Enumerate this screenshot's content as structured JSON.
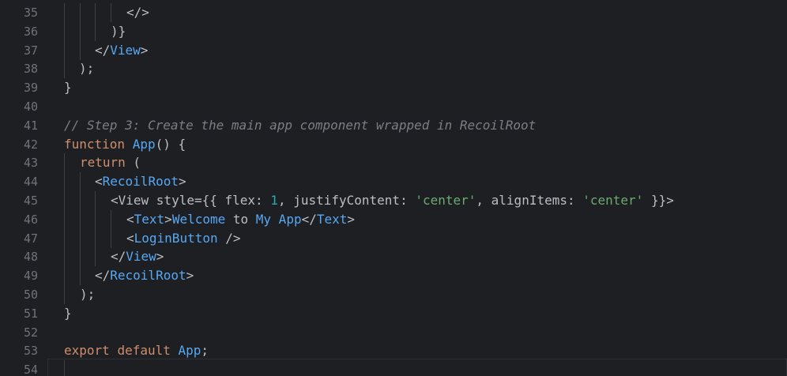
{
  "editor": {
    "lines": [
      {
        "n": "35",
        "parts": [
          {
            "t": "</>",
            "c": "br"
          }
        ]
      },
      {
        "n": "36",
        "parts": [
          {
            "t": ")}",
            "c": "br"
          }
        ]
      },
      {
        "n": "37",
        "parts": [
          {
            "t": "</",
            "c": "br"
          },
          {
            "t": "View",
            "c": "tag"
          },
          {
            "t": ">",
            "c": "br"
          }
        ]
      },
      {
        "n": "38",
        "parts": [
          {
            "t": ");",
            "c": "br"
          }
        ]
      },
      {
        "n": "39",
        "parts": [
          {
            "t": "}",
            "c": "br"
          }
        ]
      },
      {
        "n": "40",
        "parts": []
      },
      {
        "n": "41",
        "parts": [
          {
            "t": "// Step 3: Create the main app component wrapped in RecoilRoot",
            "c": "cm"
          }
        ]
      },
      {
        "n": "42",
        "parts": [
          {
            "t": "function",
            "c": "kw"
          },
          {
            "t": " ",
            "c": "br"
          },
          {
            "t": "App",
            "c": "fn"
          },
          {
            "t": "() {",
            "c": "br"
          }
        ]
      },
      {
        "n": "43",
        "parts": [
          {
            "t": "return",
            "c": "kw"
          },
          {
            "t": " (",
            "c": "br"
          }
        ]
      },
      {
        "n": "44",
        "parts": [
          {
            "t": "<",
            "c": "br"
          },
          {
            "t": "RecoilRoot",
            "c": "tag"
          },
          {
            "t": ">",
            "c": "br"
          }
        ]
      },
      {
        "n": "45",
        "parts": [
          {
            "t": "<View style={{ flex: ",
            "c": "br"
          },
          {
            "t": "1",
            "c": "num"
          },
          {
            "t": ", justifyContent: ",
            "c": "br"
          },
          {
            "t": "'center'",
            "c": "str"
          },
          {
            "t": ", alignItems: ",
            "c": "br"
          },
          {
            "t": "'center'",
            "c": "str"
          },
          {
            "t": " }}>",
            "c": "br"
          }
        ]
      },
      {
        "n": "46",
        "parts": [
          {
            "t": "<",
            "c": "br"
          },
          {
            "t": "Text",
            "c": "tag"
          },
          {
            "t": ">",
            "c": "br"
          },
          {
            "t": "Welcome",
            "c": "fn"
          },
          {
            "t": " to ",
            "c": "br"
          },
          {
            "t": "My App",
            "c": "fn"
          },
          {
            "t": "</",
            "c": "br"
          },
          {
            "t": "Text",
            "c": "tag"
          },
          {
            "t": ">",
            "c": "br"
          }
        ]
      },
      {
        "n": "47",
        "parts": [
          {
            "t": "<",
            "c": "br"
          },
          {
            "t": "LoginButton",
            "c": "tag"
          },
          {
            "t": " />",
            "c": "br"
          }
        ]
      },
      {
        "n": "48",
        "parts": [
          {
            "t": "</",
            "c": "br"
          },
          {
            "t": "View",
            "c": "tag"
          },
          {
            "t": ">",
            "c": "br"
          }
        ]
      },
      {
        "n": "49",
        "parts": [
          {
            "t": "</",
            "c": "br"
          },
          {
            "t": "RecoilRoot",
            "c": "tag"
          },
          {
            "t": ">",
            "c": "br"
          }
        ]
      },
      {
        "n": "50",
        "parts": [
          {
            "t": ");",
            "c": "br"
          }
        ]
      },
      {
        "n": "51",
        "parts": [
          {
            "t": "}",
            "c": "br"
          }
        ]
      },
      {
        "n": "52",
        "parts": []
      },
      {
        "n": "53",
        "parts": [
          {
            "t": "export",
            "c": "kw"
          },
          {
            "t": " ",
            "c": "br"
          },
          {
            "t": "default",
            "c": "kw"
          },
          {
            "t": " ",
            "c": "br"
          },
          {
            "t": "App",
            "c": "fn"
          },
          {
            "t": ";",
            "c": "br"
          }
        ]
      },
      {
        "n": "54",
        "parts": []
      }
    ]
  },
  "colors": {
    "background": "#1e1f22",
    "keyword": "#cf8e6d",
    "function": "#56a8f5",
    "string": "#6aab73",
    "number": "#2aacb8",
    "comment": "#7a7e85",
    "line_number": "#6f737a"
  }
}
